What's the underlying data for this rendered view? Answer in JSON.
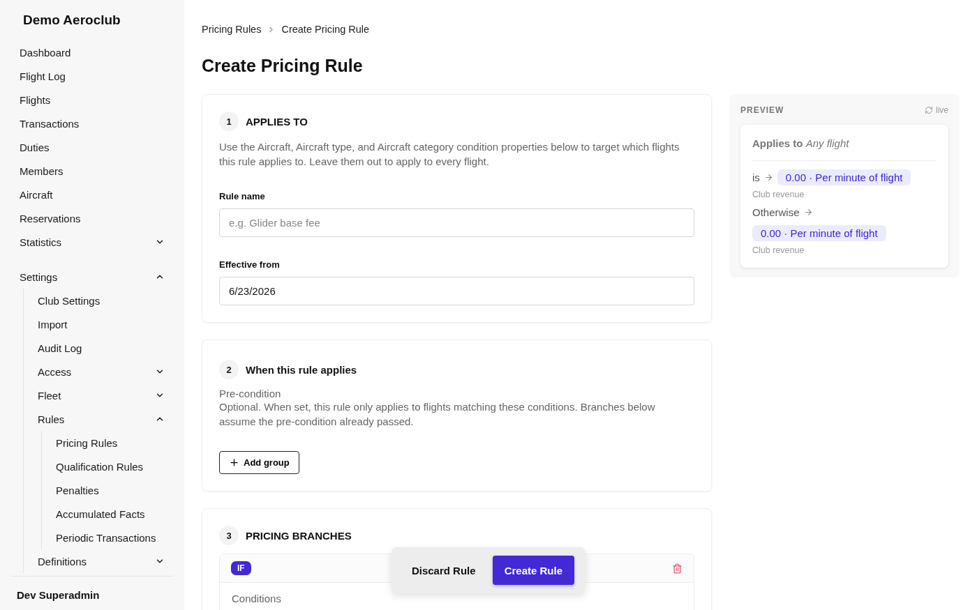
{
  "sidebar": {
    "club_name": "Demo Aeroclub",
    "items": [
      {
        "label": "Dashboard"
      },
      {
        "label": "Flight Log"
      },
      {
        "label": "Flights"
      },
      {
        "label": "Transactions"
      },
      {
        "label": "Duties"
      },
      {
        "label": "Members"
      },
      {
        "label": "Aircraft"
      },
      {
        "label": "Reservations"
      },
      {
        "label": "Statistics",
        "expanded": false
      },
      {
        "label": "Settings",
        "expanded": true,
        "children": [
          {
            "label": "Club Settings"
          },
          {
            "label": "Import"
          },
          {
            "label": "Audit Log"
          },
          {
            "label": "Access",
            "expanded": false
          },
          {
            "label": "Fleet",
            "expanded": false
          },
          {
            "label": "Rules",
            "expanded": true,
            "children": [
              {
                "label": "Pricing Rules"
              },
              {
                "label": "Qualification Rules"
              },
              {
                "label": "Penalties"
              },
              {
                "label": "Accumulated Facts"
              },
              {
                "label": "Periodic Transactions"
              }
            ]
          },
          {
            "label": "Definitions",
            "expanded": false
          }
        ]
      }
    ],
    "user": "Dev Superadmin"
  },
  "breadcrumbs": [
    "Pricing Rules",
    "Create Pricing Rule"
  ],
  "title": "Create Pricing Rule",
  "sections": [
    {
      "number": "1",
      "title": "APPLIES TO",
      "description": "Use the Aircraft, Aircraft type, and Aircraft category condition properties below to target which flights this rule applies to. Leave them out to apply to every flight.",
      "fields": [
        {
          "label": "Rule name",
          "placeholder": "e.g. Glider base fee"
        },
        {
          "label": "Effective from",
          "value": "6/23/2026"
        }
      ]
    },
    {
      "number": "2",
      "title": "When this rule applies",
      "subtitle": "Pre-condition",
      "description": "Optional. When set, this rule only applies to flights matching these conditions. Branches below assume the pre-condition already passed.",
      "button": "Add group"
    },
    {
      "number": "3",
      "title": "PRICING BRANCHES",
      "branch": {
        "badge": "IF",
        "conditions_label": "Conditions"
      }
    }
  ],
  "preview": {
    "heading": "PREVIEW",
    "live": "live",
    "applies_label": "Applies to",
    "applies_value": "Any flight",
    "rules": [
      {
        "kind": "if",
        "label": "is",
        "chip": "0.00 · Per minute of flight",
        "account": "Club revenue"
      },
      {
        "kind": "otherwise",
        "label": "Otherwise",
        "chip": "0.00 · Per minute of flight",
        "account": "Club revenue"
      }
    ]
  },
  "actions": {
    "discard": "Discard Rule",
    "create": "Create Rule"
  }
}
